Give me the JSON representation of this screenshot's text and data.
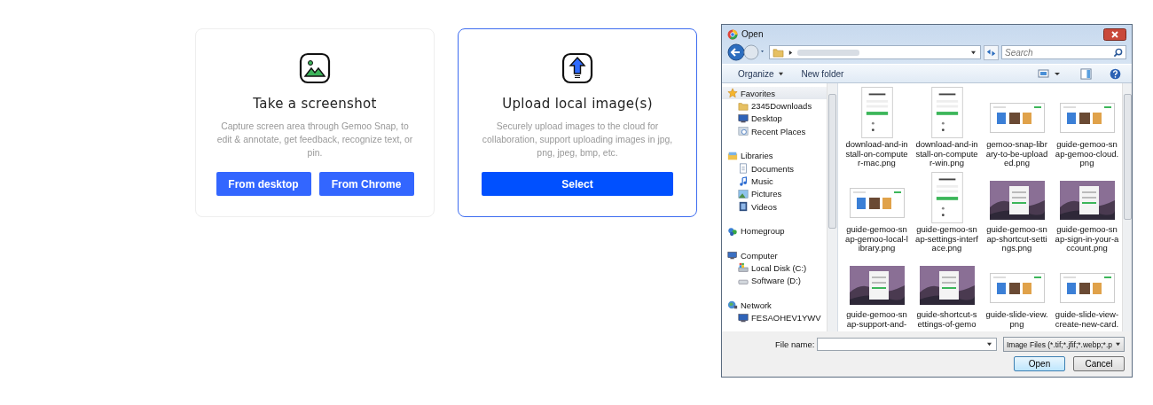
{
  "cards": [
    {
      "title": "Take a screenshot",
      "selected": false,
      "description": "Capture screen area through Gemoo Snap, to edit & annotate, get feedback, recognize text, or pin.",
      "buttons": [
        "From desktop",
        "From Chrome"
      ]
    },
    {
      "title": "Upload local image(s)",
      "selected": true,
      "description": "Securely upload images to the cloud for collaboration, support uploading images in jpg, png, jpeg, bmp, etc.",
      "buttons": [
        "Select"
      ]
    }
  ],
  "dialog": {
    "title": "Open",
    "search": {
      "placeholder": "Search"
    },
    "toolbar": [
      "Organize",
      "New folder"
    ],
    "sidebar": [
      {
        "label": "Favorites",
        "selected": true,
        "children": [
          {
            "label": "2345Downloads",
            "selected": false
          },
          {
            "label": "Desktop",
            "selected": false
          },
          {
            "label": "Recent Places",
            "selected": false
          }
        ]
      },
      {
        "label": "Libraries",
        "selected": false,
        "children": [
          {
            "label": "Documents",
            "selected": false
          },
          {
            "label": "Music",
            "selected": false
          },
          {
            "label": "Pictures",
            "selected": false
          },
          {
            "label": "Videos",
            "selected": false
          }
        ]
      },
      {
        "label": "Homegroup",
        "selected": false
      },
      {
        "label": "Computer",
        "selected": false,
        "children": [
          {
            "label": "Local Disk (C:)",
            "selected": false
          },
          {
            "label": "Software (D:)",
            "selected": false
          }
        ]
      },
      {
        "label": "Network",
        "selected": false,
        "children": [
          {
            "label": "FESAOHEV1YWV",
            "selected": false
          }
        ]
      }
    ],
    "files": [
      {
        "name": "download-and-install-on-computer-mac.png",
        "kind": "doc"
      },
      {
        "name": "download-and-install-on-computer-win.png",
        "kind": "doc"
      },
      {
        "name": "gemoo-snap-library-to-be-uploaded.png",
        "kind": "wide"
      },
      {
        "name": "guide-gemoo-snap-gemoo-cloud.png",
        "kind": "wide"
      },
      {
        "name": "guide-gemoo-snap-gemoo-local-library.png",
        "kind": "wide"
      },
      {
        "name": "guide-gemoo-snap-settings-interface.png",
        "kind": "doc"
      },
      {
        "name": "guide-gemoo-snap-shortcut-settings.png",
        "kind": "photo"
      },
      {
        "name": "guide-gemoo-snap-sign-in-your-account.png",
        "kind": "photo"
      },
      {
        "name": "guide-gemoo-snap-support-and-",
        "kind": "photo"
      },
      {
        "name": "guide-shortcut-settings-of-gemo",
        "kind": "photo"
      },
      {
        "name": "guide-slide-view.png",
        "kind": "wide"
      },
      {
        "name": "guide-slide-view-create-new-card.",
        "kind": "wide"
      }
    ],
    "filename_label": "File name:",
    "filetype": "Image Files (*.tif;*.jfif;*.webp;*.p",
    "buttons": [
      "Open",
      "Cancel"
    ]
  }
}
